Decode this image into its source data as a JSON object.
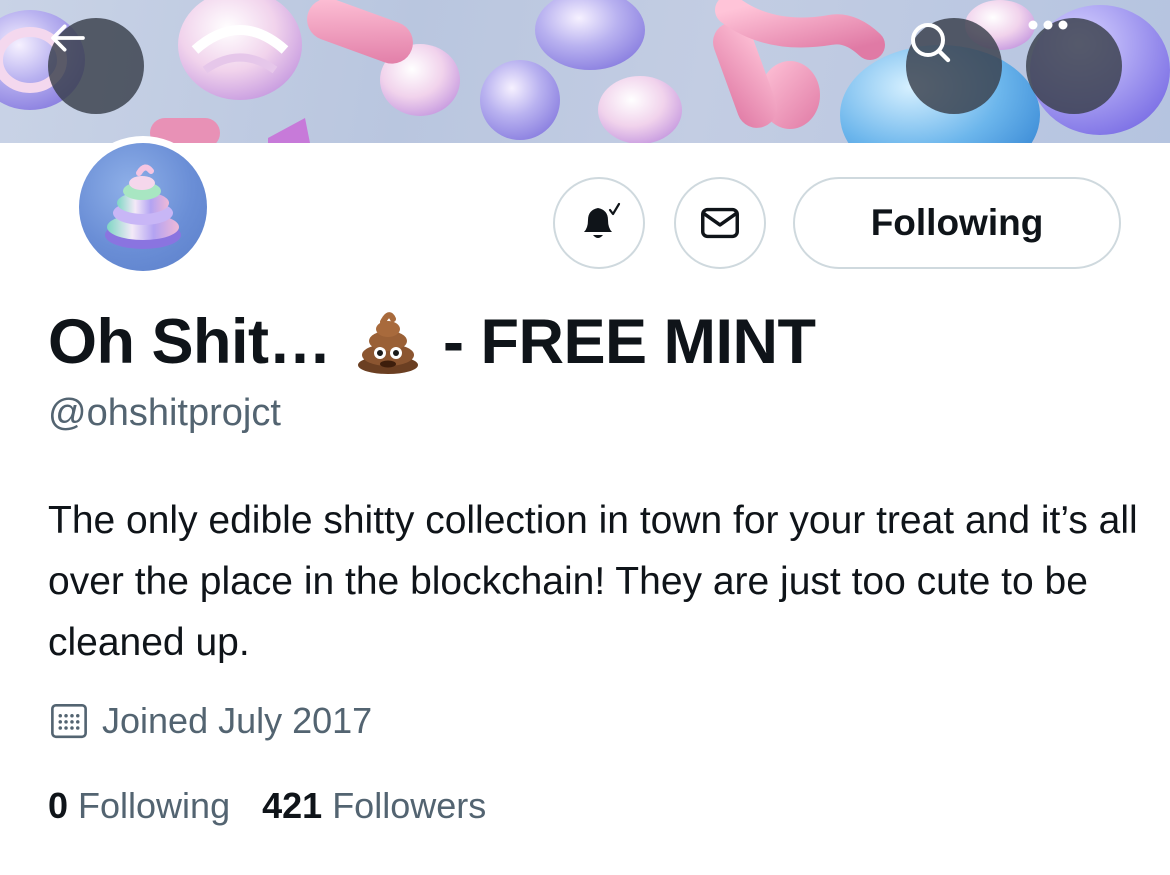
{
  "header": {
    "back_icon": "arrow-left-icon",
    "search_icon": "search-icon",
    "more_icon": "ellipsis-icon"
  },
  "profile": {
    "display_name_prefix": "Oh Shit…",
    "display_name_suffix": "- FREE MINT",
    "name_emoji_icon": "pile-of-poo-icon",
    "handle": "@ohshitprojct",
    "bio": "The only edible shitty collection in town for your treat and it’s all over the place in the blockchain! They are just too cute to be cleaned up.",
    "joined": "Joined July 2017",
    "joined_icon": "calendar-icon"
  },
  "actions": {
    "notify_icon": "bell-check-icon",
    "message_icon": "envelope-icon",
    "following_label": "Following"
  },
  "stats": {
    "following_count": "0",
    "following_label": "Following",
    "followers_count": "421",
    "followers_label": "Followers"
  },
  "colors": {
    "text_primary": "#0f1419",
    "text_secondary": "#536471",
    "border": "#cfd9de",
    "overlay_button": "#383e4a"
  }
}
